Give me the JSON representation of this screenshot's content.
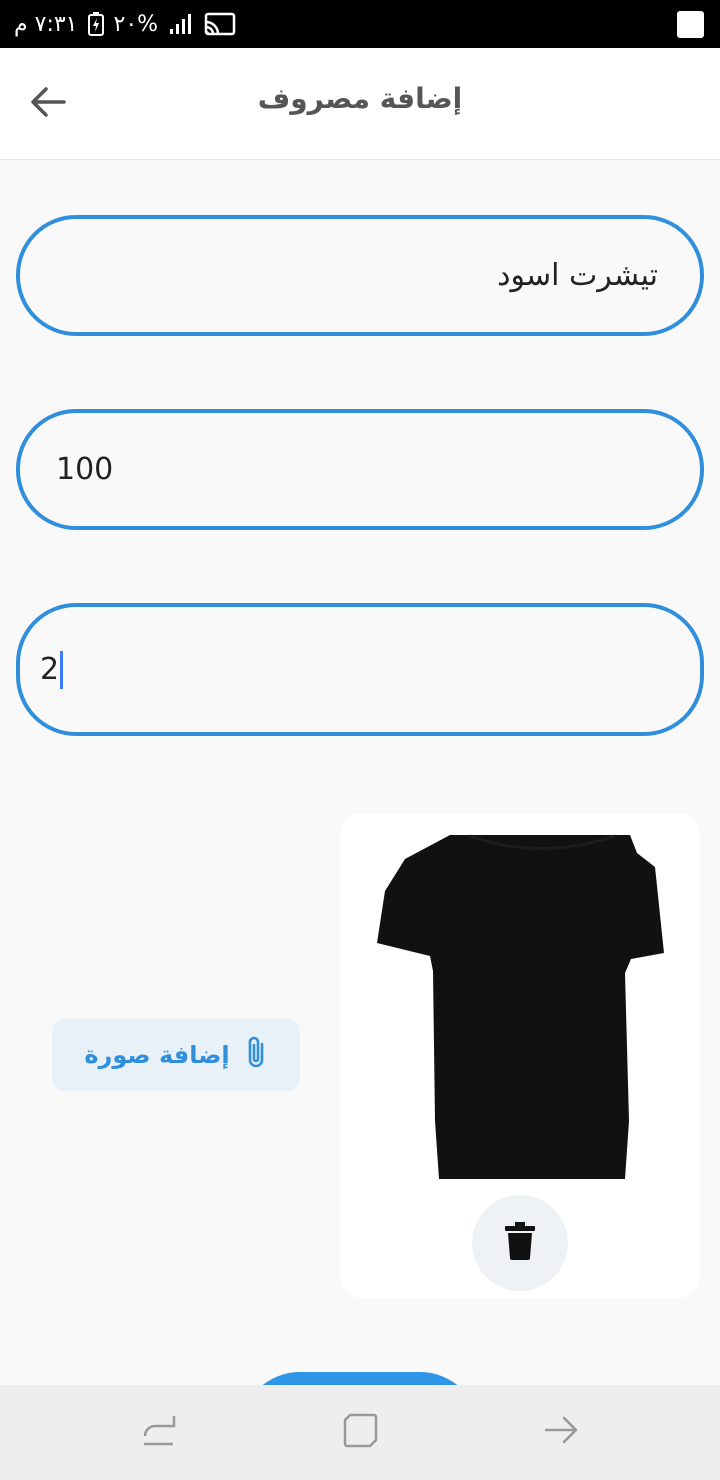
{
  "status_bar": {
    "time": "٧:٣١ م",
    "battery": "٢٠%",
    "icons": [
      "battery-icon",
      "signal-icon",
      "cast-icon",
      "notification-square-icon"
    ]
  },
  "header": {
    "title": "إضافة مصروف",
    "back_icon": "back-arrow-icon"
  },
  "form": {
    "name_value": "تيشرت اسود",
    "amount_value": "100",
    "quantity_value": "2"
  },
  "attachment": {
    "add_image_label": "إضافة صورة",
    "add_image_icon": "paperclip-icon",
    "preview_image": "black-tshirt",
    "delete_icon": "trash-icon"
  },
  "nav_bar": {
    "icons": [
      "recent-apps-icon",
      "home-icon",
      "back-icon"
    ]
  },
  "colors": {
    "accent": "#2f8fdc",
    "background": "#f9f9f9",
    "status_bar": "#000000"
  }
}
